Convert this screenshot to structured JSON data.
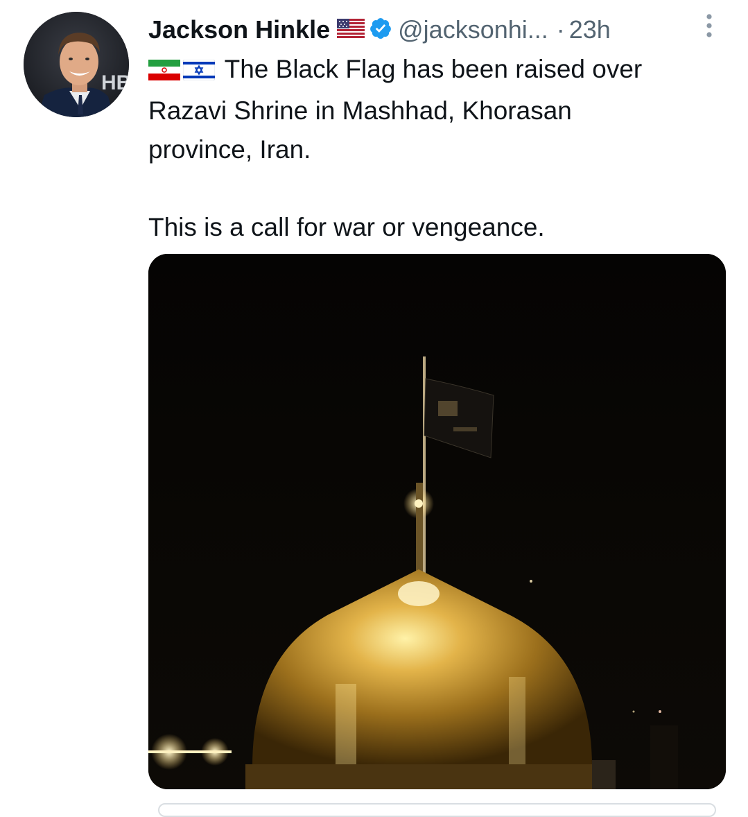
{
  "tweet": {
    "author": {
      "display_name": "Jackson Hinkle",
      "handle": "@jacksonhi...",
      "avatar_icon": "avatar-photo",
      "flag_icon": "us-flag-icon",
      "verified_icon": "verified-badge-icon"
    },
    "separator": "·",
    "timestamp": "23h",
    "more_icon": "more-vertical-icon",
    "body": {
      "flag_icons": [
        "iran-flag-icon",
        "israel-flag-icon"
      ],
      "line1": "The Black Flag has been raised over",
      "line2": "Razavi Shrine in Mashhad, Khorasan",
      "line3": "province, Iran.",
      "line4": "This is a call for war or vengeance."
    },
    "media": {
      "kind": "photo",
      "icon": "shrine-photo"
    },
    "colors": {
      "text": "#0f1419",
      "muted": "#536471",
      "verified": "#1d9bf0"
    }
  }
}
